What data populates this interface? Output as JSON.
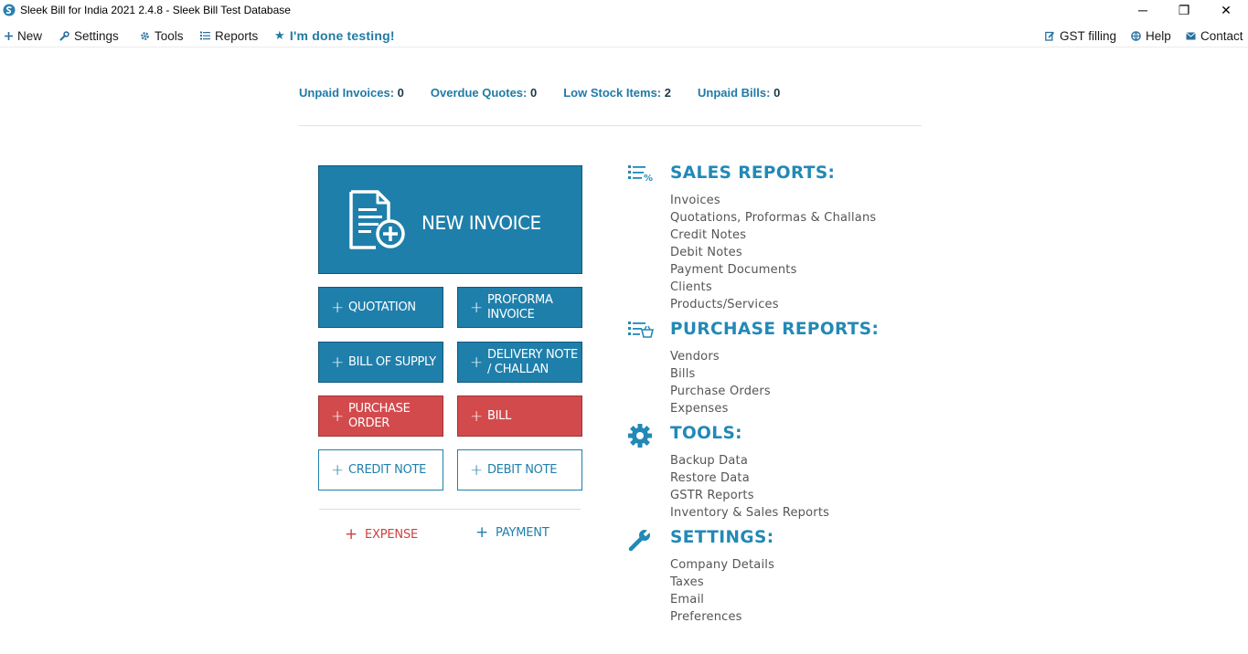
{
  "window": {
    "title": "Sleek Bill for India 2021 2.4.8 - Sleek Bill Test Database",
    "minimize": "─",
    "restore": "❐",
    "close": "✕"
  },
  "menu": {
    "new": "New",
    "settings": "Settings",
    "tools": "Tools",
    "reports": "Reports",
    "done_testing": "I'm done testing!",
    "gst_filling": "GST filling",
    "help": "Help",
    "contact": "Contact"
  },
  "stats": {
    "unpaid_invoices_label": "Unpaid Invoices:",
    "unpaid_invoices_value": "0",
    "overdue_quotes_label": "Overdue Quotes:",
    "overdue_quotes_value": "0",
    "low_stock_label": "Low Stock Items:",
    "low_stock_value": "2",
    "unpaid_bills_label": "Unpaid Bills:",
    "unpaid_bills_value": "0"
  },
  "actions": {
    "new_invoice": "NEW INVOICE",
    "quotation": "QUOTATION",
    "proforma_line1": "PROFORMA",
    "proforma_line2": "INVOICE",
    "bill_of_supply": "BILL OF SUPPLY",
    "delivery_line1": "DELIVERY NOTE",
    "delivery_line2": "/ CHALLAN",
    "purchase_line1": "PURCHASE",
    "purchase_line2": "ORDER",
    "bill": "BILL",
    "credit_note": "CREDIT NOTE",
    "debit_note": "DEBIT NOTE",
    "expense": "EXPENSE",
    "payment": "PAYMENT",
    "plus": "+"
  },
  "sections": {
    "sales": {
      "title": "SALES REPORTS:",
      "items": [
        "Invoices",
        "Quotations, Proformas & Challans",
        "Credit Notes",
        "Debit Notes",
        "Payment Documents",
        "Clients",
        "Products/Services"
      ]
    },
    "purchase": {
      "title": "PURCHASE REPORTS:",
      "items": [
        "Vendors",
        "Bills",
        "Purchase Orders",
        "Expenses"
      ]
    },
    "tools": {
      "title": "TOOLS:",
      "items": [
        "Backup Data",
        "Restore Data",
        "GSTR Reports",
        "Inventory & Sales Reports"
      ]
    },
    "settings": {
      "title": "SETTINGS:",
      "items": [
        "Company Details",
        "Taxes",
        "Email",
        "Preferences"
      ]
    }
  },
  "colors": {
    "primary_blue": "#1f7fab",
    "heading_blue": "#2289b6",
    "red": "#d34a4d"
  }
}
